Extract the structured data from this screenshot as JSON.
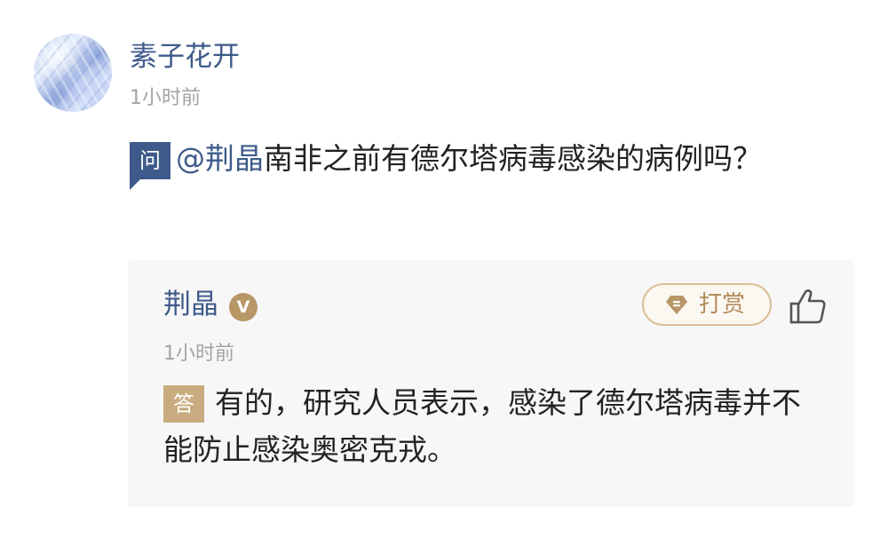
{
  "post": {
    "username": "素子花开",
    "time": "1小时前",
    "question_badge": "问",
    "mention": "@荆晶",
    "question_text": "南非之前有德尔塔病毒感染的病例吗？"
  },
  "answer": {
    "name": "荆晶",
    "verified_badge": "V",
    "reward_label": "打赏",
    "time": "1小时前",
    "answer_badge": "答",
    "text": "有的，研究人员表示，感染了德尔塔病毒并不能防止感染奥密克戎。"
  },
  "colors": {
    "link_blue": "#3e5a8a",
    "gold": "#b89766",
    "gray_text": "#a3a3a3",
    "card_bg": "#f7f7f7"
  },
  "icons": {
    "reward": "diamond-icon",
    "like": "thumbs-up-icon",
    "verified": "verified-icon"
  }
}
